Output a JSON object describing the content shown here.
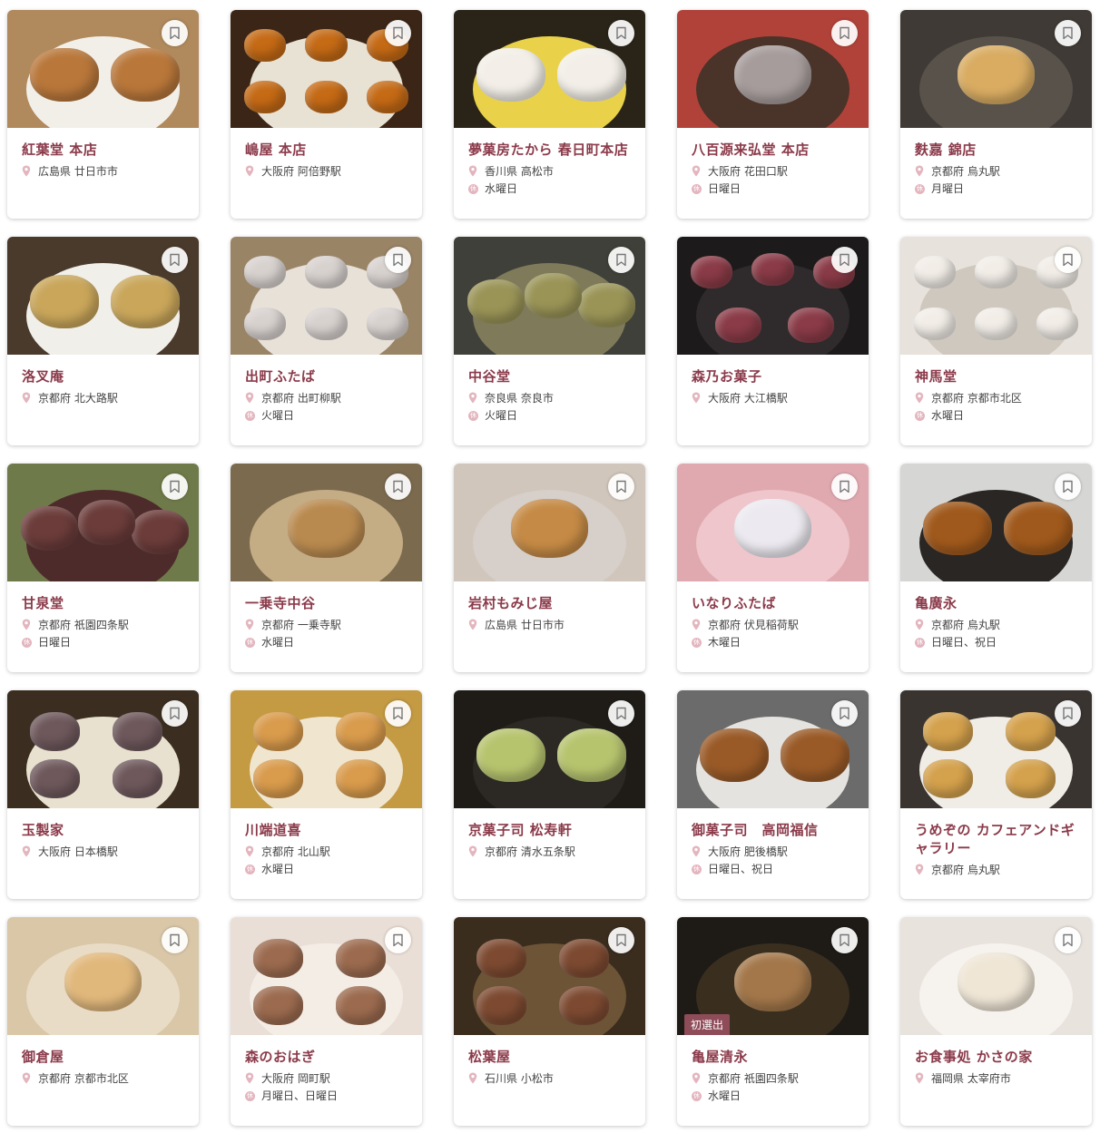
{
  "colors": {
    "accent": "#8b3a4a",
    "pin": "#e3b5bf",
    "badge": "#8e4b58"
  },
  "icons": {
    "save": "bookmark-icon",
    "location": "map-pin-icon",
    "holiday": "holiday-kanji-icon"
  },
  "holiday_icon_text": "休",
  "shops": [
    {
      "name": "紅葉堂 本店",
      "location": "広島県 廿日市市",
      "holiday": "",
      "badge": "",
      "photo": {
        "bg": "#b08a5d",
        "plate": "#f2efe9",
        "sweet": "#b9773a",
        "count": 2
      }
    },
    {
      "name": "嶋屋 本店",
      "location": "大阪府 阿倍野駅",
      "holiday": "",
      "badge": "",
      "photo": {
        "bg": "#3b2516",
        "plate": "#e8e2d4",
        "sweet": "#c56a15",
        "count": 6
      }
    },
    {
      "name": "夢菓房たから 春日町本店",
      "location": "香川県 高松市",
      "holiday": "水曜日",
      "badge": "",
      "photo": {
        "bg": "#2a2418",
        "plate": "#e9d24a",
        "sweet": "#f3efe8",
        "count": 2
      }
    },
    {
      "name": "八百源来弘堂 本店",
      "location": "大阪府 花田口駅",
      "holiday": "日曜日",
      "badge": "",
      "photo": {
        "bg": "#b1423a",
        "plate": "#4a3328",
        "sweet": "#a69c9b",
        "count": 1
      }
    },
    {
      "name": "麩嘉 錦店",
      "location": "京都府 烏丸駅",
      "holiday": "月曜日",
      "badge": "",
      "photo": {
        "bg": "#3f3a35",
        "plate": "#58524b",
        "sweet": "#d9ac62",
        "count": 1
      }
    },
    {
      "name": "洛叉庵",
      "location": "京都府 北大路駅",
      "holiday": "",
      "badge": "",
      "photo": {
        "bg": "#4a3a2c",
        "plate": "#f1efe9",
        "sweet": "#c9a65a",
        "count": 2
      }
    },
    {
      "name": "出町ふたば",
      "location": "京都府 出町柳駅",
      "holiday": "火曜日",
      "badge": "",
      "photo": {
        "bg": "#9a8466",
        "plate": "#e7e1d8",
        "sweet": "#d8d2cf",
        "count": 6
      }
    },
    {
      "name": "中谷堂",
      "location": "奈良県 奈良市",
      "holiday": "火曜日",
      "badge": "",
      "photo": {
        "bg": "#3f4039",
        "plate": "#7e7a5a",
        "sweet": "#9a9457",
        "count": 3
      }
    },
    {
      "name": "森乃お菓子",
      "location": "大阪府 大江橋駅",
      "holiday": "",
      "badge": "",
      "photo": {
        "bg": "#1c1a1b",
        "plate": "#2f2b2c",
        "sweet": "#8a3b47",
        "count": 5
      }
    },
    {
      "name": "神馬堂",
      "location": "京都府 京都市北区",
      "holiday": "水曜日",
      "badge": "",
      "photo": {
        "bg": "#e7e2db",
        "plate": "#cfc8bf",
        "sweet": "#f2ede7",
        "count": 6
      }
    },
    {
      "name": "甘泉堂",
      "location": "京都府 祇園四条駅",
      "holiday": "日曜日",
      "badge": "",
      "photo": {
        "bg": "#6f7a4a",
        "plate": "#4d2b2b",
        "sweet": "#6b3c3a",
        "count": 3
      }
    },
    {
      "name": "一乗寺中谷",
      "location": "京都府 一乗寺駅",
      "holiday": "水曜日",
      "badge": "",
      "photo": {
        "bg": "#7b6a4e",
        "plate": "#c4ac85",
        "sweet": "#b98a4f",
        "count": 1
      }
    },
    {
      "name": "岩村もみじ屋",
      "location": "広島県 廿日市市",
      "holiday": "",
      "badge": "",
      "photo": {
        "bg": "#d1c6bb",
        "plate": "#d6cfca",
        "sweet": "#c58a45",
        "count": 1
      }
    },
    {
      "name": "いなりふたば",
      "location": "京都府 伏見稲荷駅",
      "holiday": "木曜日",
      "badge": "",
      "photo": {
        "bg": "#e0a9b0",
        "plate": "#eec6cb",
        "sweet": "#eceaf0",
        "count": 1
      }
    },
    {
      "name": "亀廣永",
      "location": "京都府 烏丸駅",
      "holiday": "日曜日、祝日",
      "badge": "",
      "photo": {
        "bg": "#d6d6d4",
        "plate": "#2a2624",
        "sweet": "#a0591c",
        "count": 2
      }
    },
    {
      "name": "玉製家",
      "location": "大阪府 日本橋駅",
      "holiday": "",
      "badge": "",
      "photo": {
        "bg": "#3b2e20",
        "plate": "#e9e1cf",
        "sweet": "#6e585c",
        "count": 4
      }
    },
    {
      "name": "川端道喜",
      "location": "京都府 北山駅",
      "holiday": "水曜日",
      "badge": "",
      "photo": {
        "bg": "#c49a43",
        "plate": "#f0e6cf",
        "sweet": "#d99b4c",
        "count": 4
      }
    },
    {
      "name": "京菓子司 松寿軒",
      "location": "京都府 清水五条駅",
      "holiday": "",
      "badge": "",
      "photo": {
        "bg": "#1f1c18",
        "plate": "#2c2924",
        "sweet": "#b7c46e",
        "count": 2
      }
    },
    {
      "name": "御菓子司　高岡福信",
      "location": "大阪府 肥後橋駅",
      "holiday": "日曜日、祝日",
      "badge": "",
      "photo": {
        "bg": "#6b6b6b",
        "plate": "#e5e3e0",
        "sweet": "#9a5a27",
        "count": 2
      }
    },
    {
      "name": "うめぞの カフェアンドギャラリー",
      "location": "京都府 烏丸駅",
      "holiday": "",
      "badge": "",
      "photo": {
        "bg": "#3a3431",
        "plate": "#f0ece6",
        "sweet": "#d4a14c",
        "count": 4
      }
    },
    {
      "name": "御倉屋",
      "location": "京都府 京都市北区",
      "holiday": "",
      "badge": "",
      "photo": {
        "bg": "#d9c7a8",
        "plate": "#e9dcc6",
        "sweet": "#e1b87c",
        "count": 1
      }
    },
    {
      "name": "森のおはぎ",
      "location": "大阪府 岡町駅",
      "holiday": "月曜日、日曜日",
      "badge": "",
      "photo": {
        "bg": "#eadfd6",
        "plate": "#f4ede6",
        "sweet": "#9c6b4f",
        "count": 4
      }
    },
    {
      "name": "松葉屋",
      "location": "石川県 小松市",
      "holiday": "",
      "badge": "",
      "photo": {
        "bg": "#3a2d1e",
        "plate": "#6d5436",
        "sweet": "#7d4a31",
        "count": 4
      }
    },
    {
      "name": "亀屋清永",
      "location": "京都府 祇園四条駅",
      "holiday": "水曜日",
      "badge": "初選出",
      "photo": {
        "bg": "#1e1b17",
        "plate": "#3a2f1f",
        "sweet": "#a3774a",
        "count": 1
      }
    },
    {
      "name": "お食事処 かさの家",
      "location": "福岡県 太宰府市",
      "holiday": "",
      "badge": "",
      "photo": {
        "bg": "#e9e3de",
        "plate": "#f6f2ee",
        "sweet": "#efe6d6",
        "count": 1
      }
    }
  ]
}
